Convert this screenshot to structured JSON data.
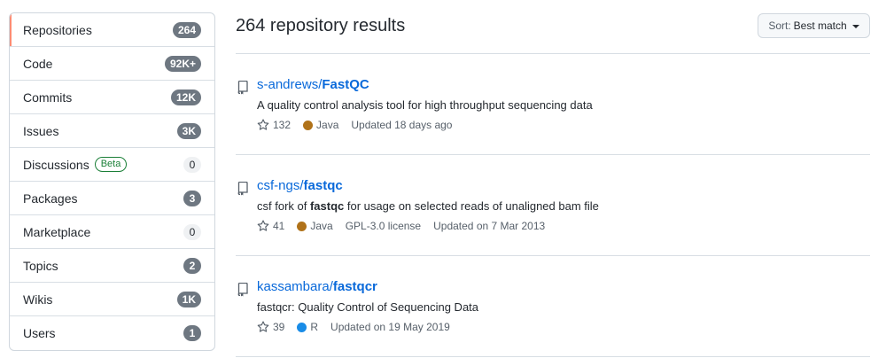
{
  "sidebar": {
    "items": [
      {
        "label": "Repositories",
        "count": "264",
        "selected": true
      },
      {
        "label": "Code",
        "count": "92K+"
      },
      {
        "label": "Commits",
        "count": "12K"
      },
      {
        "label": "Issues",
        "count": "3K"
      },
      {
        "label": "Discussions",
        "badge": "Beta",
        "count": "0"
      },
      {
        "label": "Packages",
        "count": "3"
      },
      {
        "label": "Marketplace",
        "count": "0"
      },
      {
        "label": "Topics",
        "count": "2"
      },
      {
        "label": "Wikis",
        "count": "1K"
      },
      {
        "label": "Users",
        "count": "1"
      }
    ]
  },
  "header": {
    "title": "264 repository results",
    "sort_prefix": "Sort:",
    "sort_value": "Best match"
  },
  "results": [
    {
      "owner": "s-andrews",
      "sep": "/",
      "name": "FastQC",
      "desc_before": "A quality control analysis tool for high throughput sequencing data",
      "desc_hl": "",
      "desc_after": "",
      "stars": "132",
      "language": "Java",
      "lang_color": "#b07219",
      "license": "",
      "updated": "Updated 18 days ago"
    },
    {
      "owner": "csf-ngs",
      "sep": "/",
      "name": "fastqc",
      "desc_before": "csf fork of ",
      "desc_hl": "fastqc",
      "desc_after": " for usage on selected reads of unaligned bam file",
      "stars": "41",
      "language": "Java",
      "lang_color": "#b07219",
      "license": "GPL-3.0 license",
      "updated": "Updated on 7 Mar 2013"
    },
    {
      "owner": "kassambara",
      "sep": "/",
      "name": "fastqcr",
      "desc_before": "fastqcr: Quality Control of Sequencing Data",
      "desc_hl": "",
      "desc_after": "",
      "stars": "39",
      "language": "R",
      "lang_color": "#198ce7",
      "license": "",
      "updated": "Updated on 19 May 2019"
    }
  ],
  "icons": {
    "repo": "repo-icon",
    "star": "star-icon",
    "caret": "caret-down-icon"
  },
  "colors": {
    "link": "#0969da",
    "selected_accent": "#fd8c73",
    "counter_bg": "#6e7781",
    "beta": "#1a7f37"
  }
}
